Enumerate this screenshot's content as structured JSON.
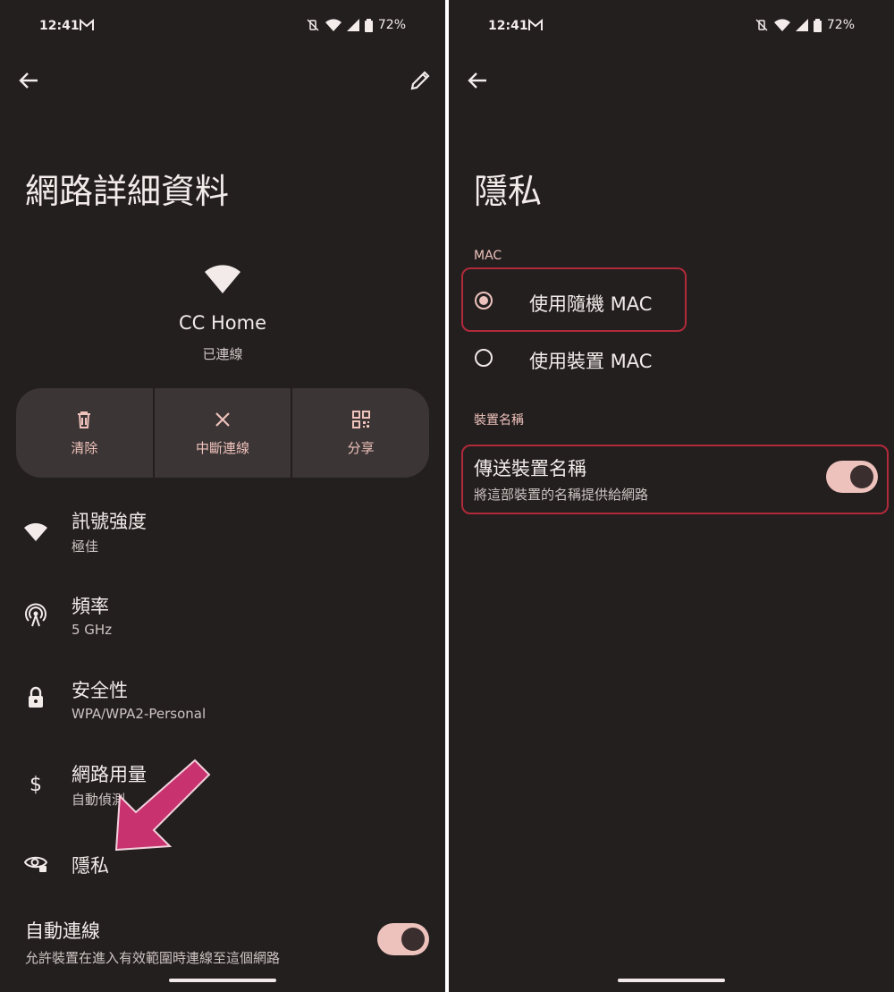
{
  "status_bar": {
    "time": "12:41",
    "battery": "72%"
  },
  "left": {
    "title": "網路詳細資料",
    "network_name": "CC Home",
    "network_status": "已連線",
    "actions": [
      {
        "label": "清除",
        "icon": "trash-icon"
      },
      {
        "label": "中斷連線",
        "icon": "close-icon"
      },
      {
        "label": "分享",
        "icon": "qr-code-icon"
      }
    ],
    "details": [
      {
        "title": "訊號強度",
        "value": "極佳",
        "icon": "wifi-icon"
      },
      {
        "title": "頻率",
        "value": "5 GHz",
        "icon": "antenna-icon"
      },
      {
        "title": "安全性",
        "value": "WPA/WPA2-Personal",
        "icon": "lock-icon"
      },
      {
        "title": "網路用量",
        "value": "自動偵測",
        "icon": "dollar-icon"
      },
      {
        "title": "隱私",
        "icon": "privacy-eye-icon"
      }
    ],
    "auto_connect": {
      "title": "自動連線",
      "description": "允許裝置在進入有效範圍時連線至這個網路",
      "enabled": true
    }
  },
  "right": {
    "title": "隱私",
    "mac_section_label": "MAC",
    "mac_options": [
      {
        "label": "使用隨機 MAC",
        "selected": true
      },
      {
        "label": "使用裝置 MAC",
        "selected": false
      }
    ],
    "device_name_section_label": "裝置名稱",
    "send_device_name": {
      "title": "傳送裝置名稱",
      "description": "將這部裝置的名稱提供給網路",
      "enabled": true
    }
  },
  "colors": {
    "background": "#231f1f",
    "accent": "#eec2bc",
    "annotation_arrow": "#c8326e",
    "highlight_box": "#b02a3a"
  }
}
